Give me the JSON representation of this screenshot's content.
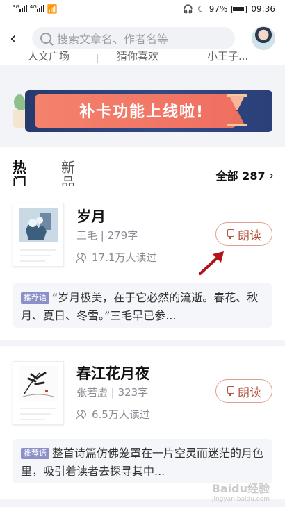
{
  "status_bar": {
    "signal_left": "3G",
    "signal_right": "4G",
    "battery": "97%",
    "time": "09:36"
  },
  "header": {
    "search_placeholder": "搜索文章名、作者名等"
  },
  "categories": [
    "人文广场",
    "猜你喜欢",
    "小王子..."
  ],
  "banner": {
    "text": "补卡功能上线啦!"
  },
  "tabs": {
    "hot": "热门",
    "new": "新品",
    "all_label": "全部 287"
  },
  "books": [
    {
      "title": "岁月",
      "meta": "三毛 | 279字",
      "readers": "17.1万人读过",
      "read_label": "朗读",
      "rec_badge": "推荐语",
      "rec_text": "“岁月极美，在于它必然的流逝。春花、秋月、夏日、冬雪。”三毛早已参..."
    },
    {
      "title": "春江花月夜",
      "meta": "张若虚 | 323字",
      "readers": "6.5万人读过",
      "read_label": "朗读",
      "rec_badge": "推荐语",
      "rec_text": "整首诗篇仿佛笼罩在一片空灵而迷茫的月色里，吸引着读者去探寻其中..."
    }
  ],
  "watermark": {
    "brand": "Baidu经验",
    "url": "jingyan.baidu.com"
  },
  "colors": {
    "accent": "#b5553f",
    "banner_bg": "#2b3f78",
    "banner_pill": "#f06f62",
    "arrow": "#b3121a"
  }
}
